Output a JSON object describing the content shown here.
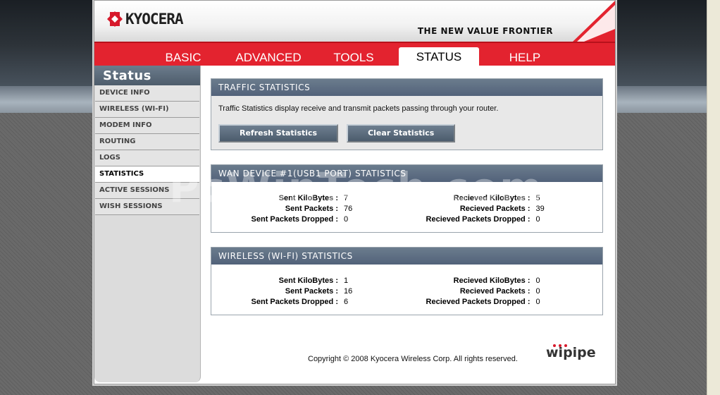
{
  "brand": {
    "logo_text": "KYOCERA",
    "tagline": "THE NEW VALUE FRONTIER"
  },
  "nav": {
    "tabs": [
      {
        "label": "BASIC"
      },
      {
        "label": "ADVANCED"
      },
      {
        "label": "TOOLS"
      },
      {
        "label": "STATUS",
        "active": true
      },
      {
        "label": "HELP"
      }
    ]
  },
  "sidebar": {
    "title": "Status",
    "items": [
      {
        "label": "DEVICE INFO"
      },
      {
        "label": "WIRELESS (WI-FI)"
      },
      {
        "label": "MODEM INFO"
      },
      {
        "label": "ROUTING"
      },
      {
        "label": "LOGS"
      },
      {
        "label": "STATISTICS",
        "active": true
      },
      {
        "label": "ACTIVE SESSIONS"
      },
      {
        "label": "WISH SESSIONS"
      }
    ]
  },
  "traffic": {
    "title": "TRAFFIC STATISTICS",
    "description": "Traffic Statistics display receive and transmit packets passing through your router.",
    "refresh_label": "Refresh Statistics",
    "clear_label": "Clear Statistics"
  },
  "wan": {
    "title": "WAN DEVICE #1(USB1 PORT) STATISTICS",
    "sent": [
      {
        "label": "Sent KiloBytes :",
        "value": "7"
      },
      {
        "label": "Sent Packets :",
        "value": "76"
      },
      {
        "label": "Sent Packets Dropped :",
        "value": "0"
      }
    ],
    "received": [
      {
        "label": "Recieved KiloBytes :",
        "value": "5"
      },
      {
        "label": "Recieved Packets :",
        "value": "39"
      },
      {
        "label": "Recieved Packets Dropped :",
        "value": "0"
      }
    ]
  },
  "wifi": {
    "title": "WIRELESS (WI-FI) STATISTICS",
    "sent": [
      {
        "label": "Sent KiloBytes :",
        "value": "1"
      },
      {
        "label": "Sent Packets :",
        "value": "16"
      },
      {
        "label": "Sent Packets Dropped :",
        "value": "6"
      }
    ],
    "received": [
      {
        "label": "Recieved KiloBytes :",
        "value": "0"
      },
      {
        "label": "Recieved Packets :",
        "value": "0"
      },
      {
        "label": "Recieved Packets Dropped :",
        "value": "0"
      }
    ]
  },
  "footer": {
    "copyright": "Copyright © 2008 Kyocera Wireless Corp. All rights reserved.",
    "partner_logo": "wipipe"
  },
  "watermark": "PcWinTech.com",
  "colors": {
    "nav_red": "#e3232f",
    "panel_header": "#52627a"
  }
}
